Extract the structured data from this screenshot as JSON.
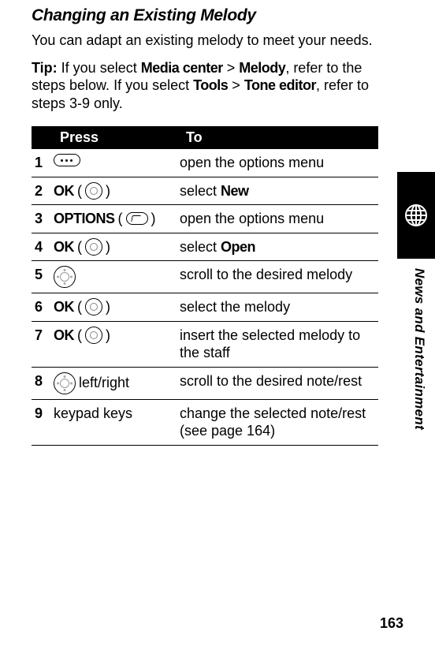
{
  "heading": "Changing an Existing Melody",
  "intro": "You can adapt an existing melody to meet your needs.",
  "tip_label": "Tip:",
  "tip_p1a": " If you select ",
  "tip_m1": "Media center",
  "tip_gt": " > ",
  "tip_m2": "Melody",
  "tip_p1b": ", refer to the steps below. If you select ",
  "tip_m3": "Tools",
  "tip_m4": "Tone editor",
  "tip_p1c": ", refer to steps 3-9 only.",
  "table": {
    "head_press": "Press",
    "head_to": "To",
    "rows": [
      {
        "n": "1",
        "icon": "menukey",
        "press_pre": "",
        "press_key": "",
        "press_post": "",
        "to": "open the options menu"
      },
      {
        "n": "2",
        "icon": "circlekey",
        "press_pre": "OK",
        "press_key": "",
        "press_post": "",
        "to_pre": "select ",
        "to_bold": "New",
        "to_post": ""
      },
      {
        "n": "3",
        "icon": "softkey",
        "press_pre": "OPTIONS",
        "press_key": "",
        "press_post": "",
        "to": "open the options menu"
      },
      {
        "n": "4",
        "icon": "circlekey",
        "press_pre": "OK",
        "press_key": "",
        "press_post": "",
        "to_pre": "select ",
        "to_bold": "Open",
        "to_post": ""
      },
      {
        "n": "5",
        "icon": "dpad",
        "press_pre": "",
        "press_key": "",
        "press_post": "",
        "to": "scroll to the desired melody"
      },
      {
        "n": "6",
        "icon": "circlekey",
        "press_pre": "OK",
        "press_key": "",
        "press_post": "",
        "to": "select the melody"
      },
      {
        "n": "7",
        "icon": "circlekey",
        "press_pre": "OK",
        "press_key": "",
        "press_post": "",
        "to": "insert the selected melody to the staff"
      },
      {
        "n": "8",
        "icon": "dpad",
        "press_pre": "",
        "press_key": "",
        "press_post": " left/right",
        "to": "scroll to the desired note/rest"
      },
      {
        "n": "9",
        "icon": "",
        "press_pre": "",
        "press_key": "keypad keys",
        "press_post": "",
        "to": "change the selected note/rest (see page 164)"
      }
    ]
  },
  "side_label": "News and Entertainment",
  "page_number": "163"
}
